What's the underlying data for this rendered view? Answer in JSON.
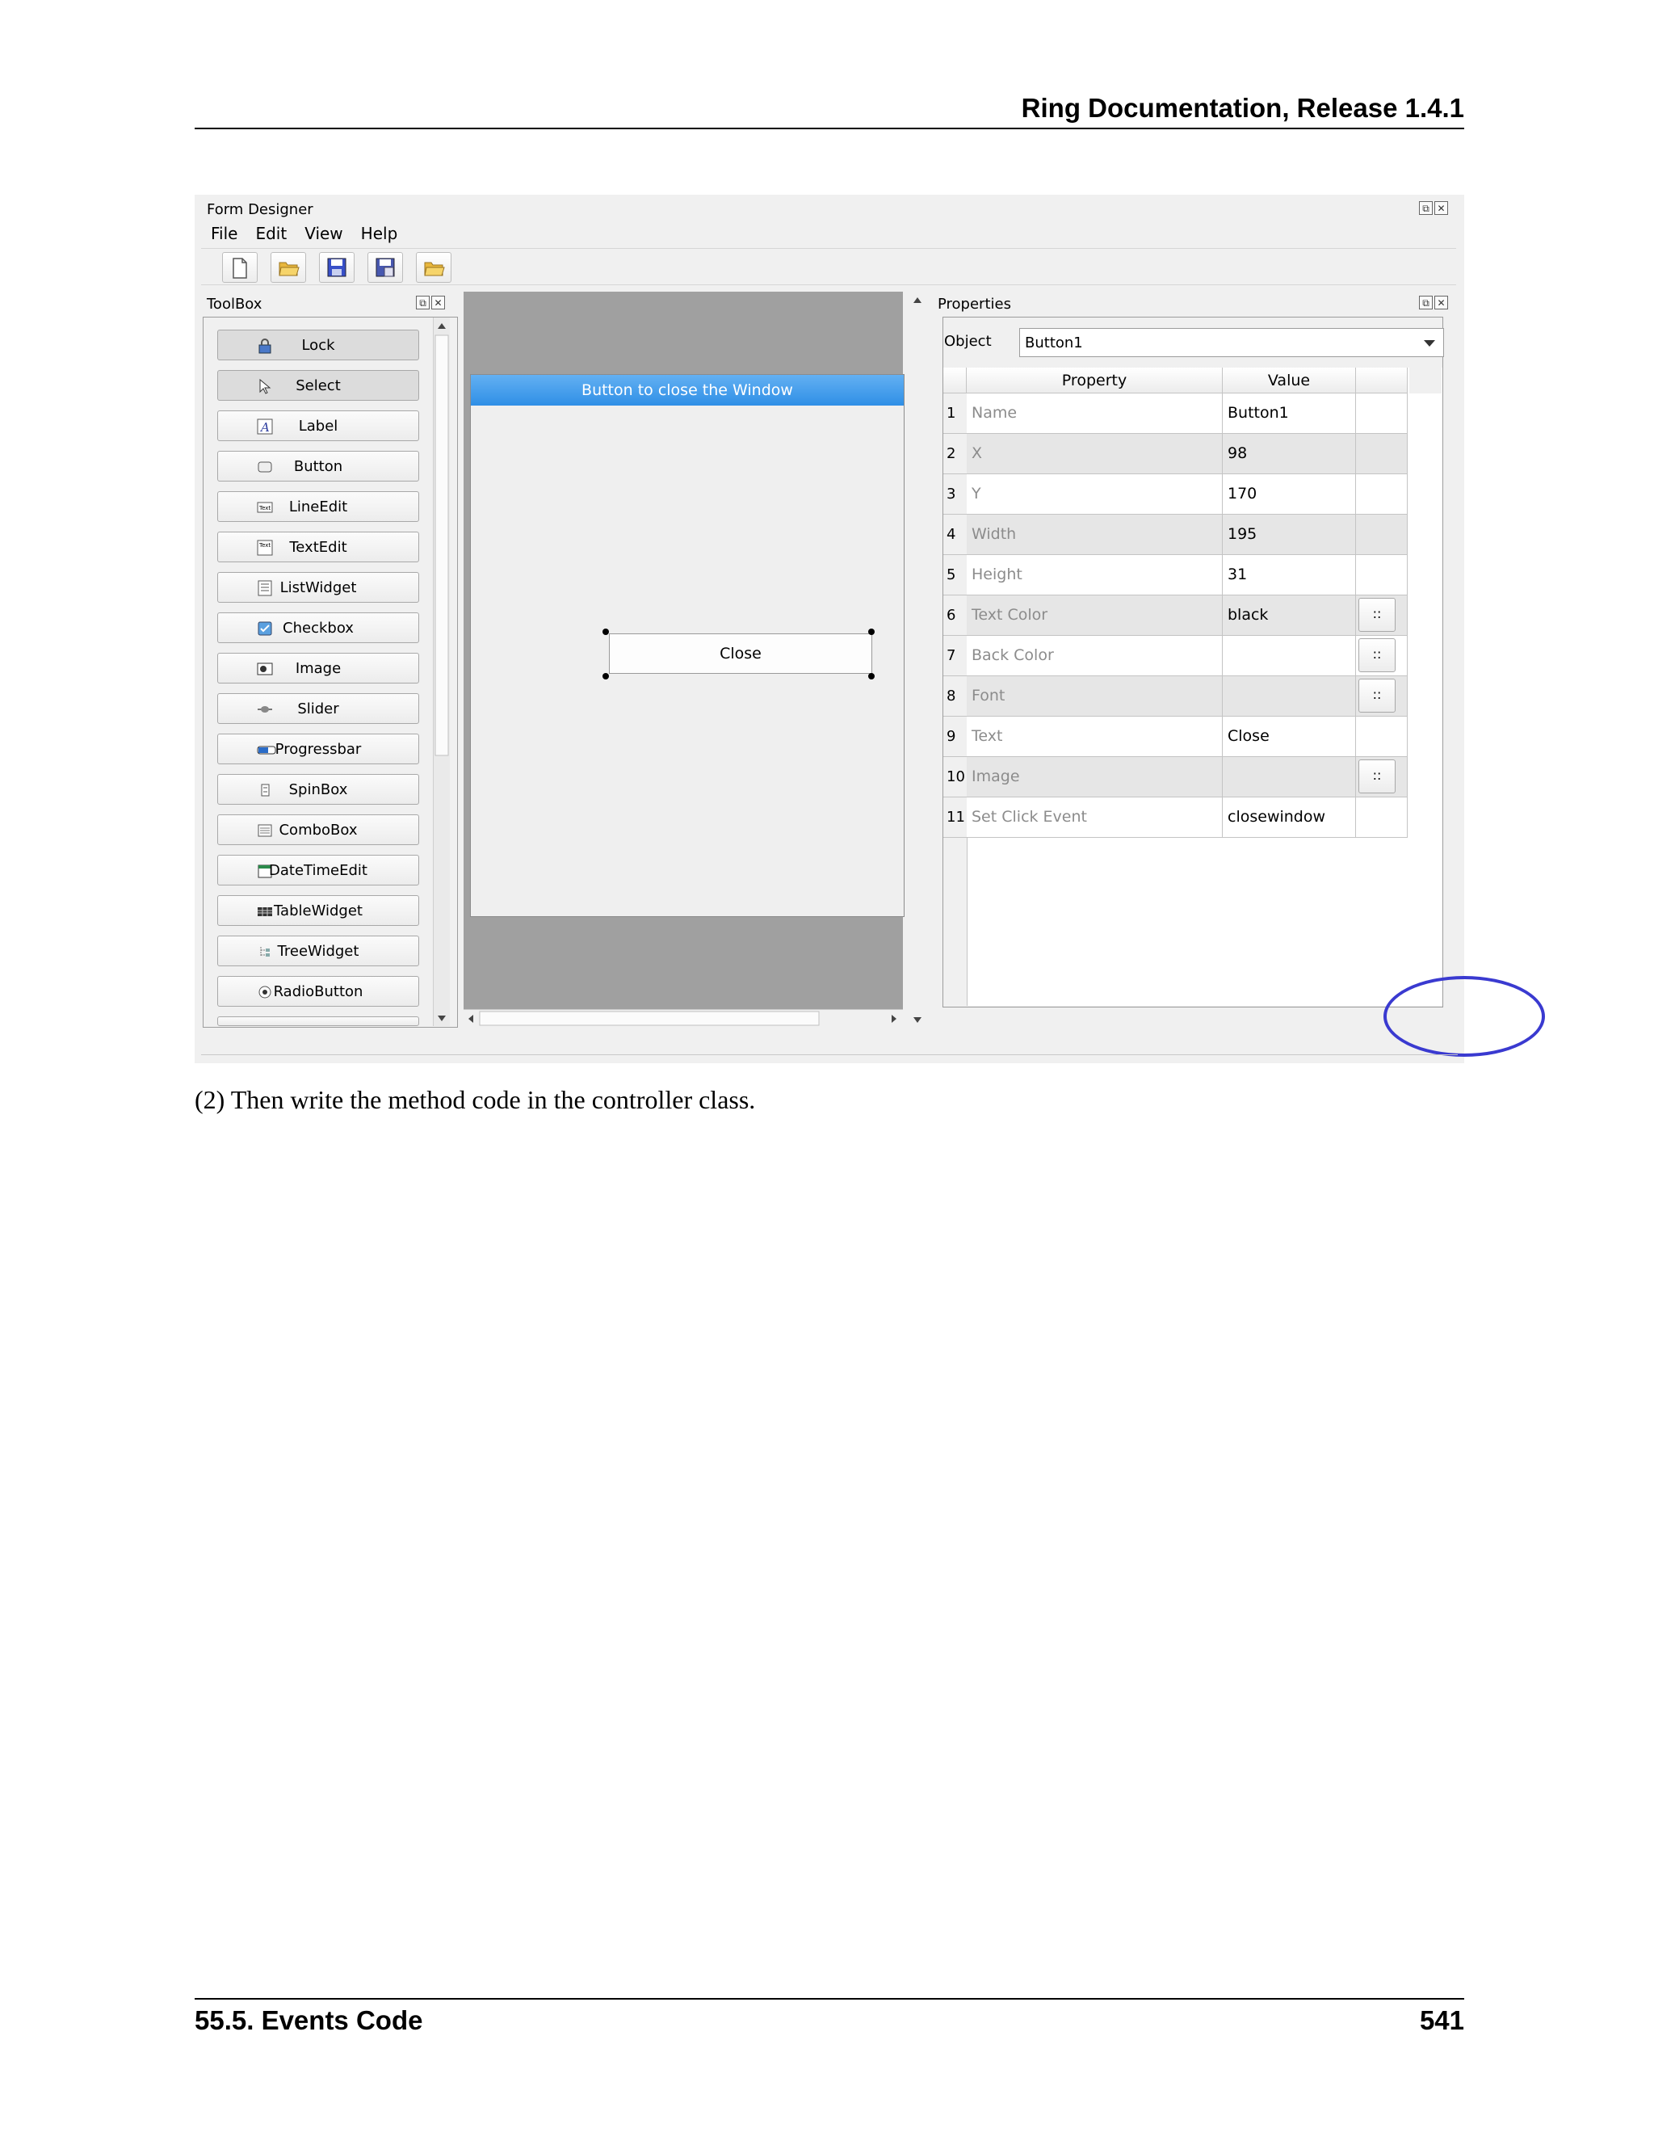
{
  "page": {
    "header": "Ring Documentation, Release 1.4.1",
    "caption": "(2) Then write the method code in the controller class.",
    "footer_section": "55.5.  Events Code",
    "footer_page": "541"
  },
  "window": {
    "title": "Form Designer",
    "menu": [
      "File",
      "Edit",
      "View",
      "Help"
    ],
    "toolbar_icons": [
      "new-file-icon",
      "open-folder-icon",
      "save-icon",
      "save-as-icon",
      "open-form-icon"
    ]
  },
  "toolbox": {
    "title": "ToolBox",
    "items": [
      {
        "label": "Lock",
        "icon": "lock-icon"
      },
      {
        "label": "Select",
        "icon": "cursor-icon"
      },
      {
        "label": "Label",
        "icon": "label-icon"
      },
      {
        "label": "Button",
        "icon": "button-icon"
      },
      {
        "label": "LineEdit",
        "icon": "lineedit-icon"
      },
      {
        "label": "TextEdit",
        "icon": "textedit-icon"
      },
      {
        "label": "ListWidget",
        "icon": "listwidget-icon"
      },
      {
        "label": "Checkbox",
        "icon": "checkbox-icon"
      },
      {
        "label": "Image",
        "icon": "image-icon"
      },
      {
        "label": "Slider",
        "icon": "slider-icon"
      },
      {
        "label": "Progressbar",
        "icon": "progressbar-icon"
      },
      {
        "label": "SpinBox",
        "icon": "spinbox-icon"
      },
      {
        "label": "ComboBox",
        "icon": "combobox-icon"
      },
      {
        "label": "DateTimeEdit",
        "icon": "datetime-icon"
      },
      {
        "label": "TableWidget",
        "icon": "tablewidget-icon"
      },
      {
        "label": "TreeWidget",
        "icon": "treewidget-icon"
      },
      {
        "label": "RadioButton",
        "icon": "radiobutton-icon"
      }
    ],
    "icon_glyphs": {
      "lineedit": "Text",
      "textedit": "Text"
    }
  },
  "form": {
    "title": "Button to close the Window",
    "button_text": "Close"
  },
  "properties": {
    "title": "Properties",
    "object_label": "Object",
    "object_value": "Button1",
    "col_property": "Property",
    "col_value": "Value",
    "ellipsis": "::",
    "rows": [
      {
        "num": "1",
        "name": "Name",
        "value": "Button1"
      },
      {
        "num": "2",
        "name": "X",
        "value": "98"
      },
      {
        "num": "3",
        "name": "Y",
        "value": "170"
      },
      {
        "num": "4",
        "name": "Width",
        "value": "195"
      },
      {
        "num": "5",
        "name": "Height",
        "value": "31"
      },
      {
        "num": "6",
        "name": "Text Color",
        "value": "black"
      },
      {
        "num": "7",
        "name": "Back Color",
        "value": ""
      },
      {
        "num": "8",
        "name": "Font",
        "value": ""
      },
      {
        "num": "9",
        "name": "Text",
        "value": "Close"
      },
      {
        "num": "10",
        "name": "Image",
        "value": ""
      },
      {
        "num": "11",
        "name": "Set Click Event",
        "value": "closewindow"
      }
    ]
  },
  "colors": {
    "form_title_bar": "#3a96e8",
    "highlight_circle": "#3a3ad0"
  }
}
